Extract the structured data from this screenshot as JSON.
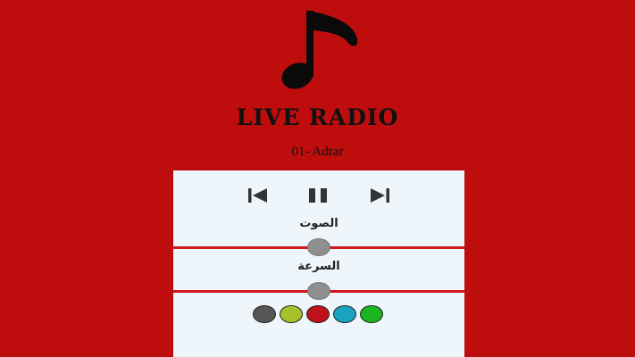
{
  "app": {
    "title": "LIVE RADIO",
    "logo_icon": "music-note-icon",
    "station": "01- Adrar"
  },
  "controls": {
    "previous_icon": "skip-previous-icon",
    "pause_icon": "pause-icon",
    "next_icon": "skip-next-icon"
  },
  "volume": {
    "label": "الصوت",
    "value": 0.5
  },
  "speed": {
    "label": "السرعة",
    "value": 0.5
  },
  "theme_colors": [
    "#555555",
    "#a6c12a",
    "#c0101a",
    "#1aa3c1",
    "#1ab51f"
  ],
  "colors": {
    "background": "#bd0d0d",
    "panel": "#eef6fc",
    "slider_track": "#d01818",
    "slider_thumb": "#8f8f8f",
    "icon": "#333333"
  }
}
